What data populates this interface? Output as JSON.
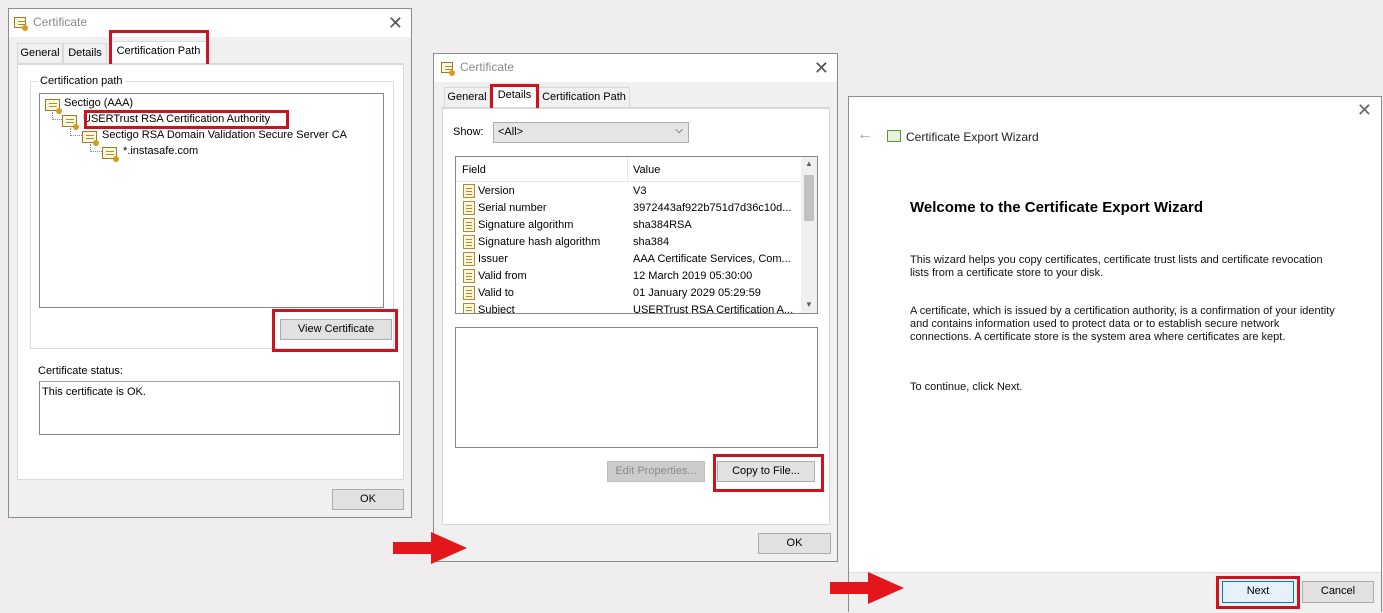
{
  "colors": {
    "highlight_red": "#d0121e",
    "arrow_red": "#e3161b"
  },
  "dialog1": {
    "title": "Certificate",
    "tabs": [
      {
        "label": "General"
      },
      {
        "label": "Details"
      },
      {
        "label": "Certification Path"
      }
    ],
    "active_tab": "Certification Path",
    "path_group_label": "Certification path",
    "tree": [
      {
        "label": "Sectigo (AAA)"
      },
      {
        "label": "USERTrust RSA Certification Authority"
      },
      {
        "label": "Sectigo RSA Domain Validation Secure Server CA"
      },
      {
        "label": "*.instasafe.com"
      }
    ],
    "view_certificate_label": "View Certificate",
    "status_label": "Certificate status:",
    "status_text": "This certificate is OK.",
    "ok_label": "OK"
  },
  "dialog2": {
    "title": "Certificate",
    "tabs": [
      {
        "label": "General"
      },
      {
        "label": "Details"
      },
      {
        "label": "Certification Path"
      }
    ],
    "active_tab": "Details",
    "show_label": "Show:",
    "show_value": "<All>",
    "columns": {
      "field": "Field",
      "value": "Value"
    },
    "rows": [
      {
        "field": "Version",
        "value": "V3"
      },
      {
        "field": "Serial number",
        "value": "3972443af922b751d7d36c10d..."
      },
      {
        "field": "Signature algorithm",
        "value": "sha384RSA"
      },
      {
        "field": "Signature hash algorithm",
        "value": "sha384"
      },
      {
        "field": "Issuer",
        "value": "AAA Certificate Services, Com..."
      },
      {
        "field": "Valid from",
        "value": "12 March 2019 05:30:00"
      },
      {
        "field": "Valid to",
        "value": "01 January 2029 05:29:59"
      },
      {
        "field": "Subject",
        "value": "USERTrust RSA Certification A..."
      }
    ],
    "edit_properties_label": "Edit Properties...",
    "copy_to_file_label": "Copy to File...",
    "ok_label": "OK"
  },
  "wizard": {
    "title": "Certificate Export Wizard",
    "heading": "Welcome to the Certificate Export Wizard",
    "para1": "This wizard helps you copy certificates, certificate trust lists and certificate revocation lists from a certificate store to your disk.",
    "para2": "A certificate, which is issued by a certification authority, is a confirmation of your identity and contains information used to protect data or to establish secure network connections. A certificate store is the system area where certificates are kept.",
    "para3": "To continue, click Next.",
    "next_label": "Next",
    "cancel_label": "Cancel"
  }
}
